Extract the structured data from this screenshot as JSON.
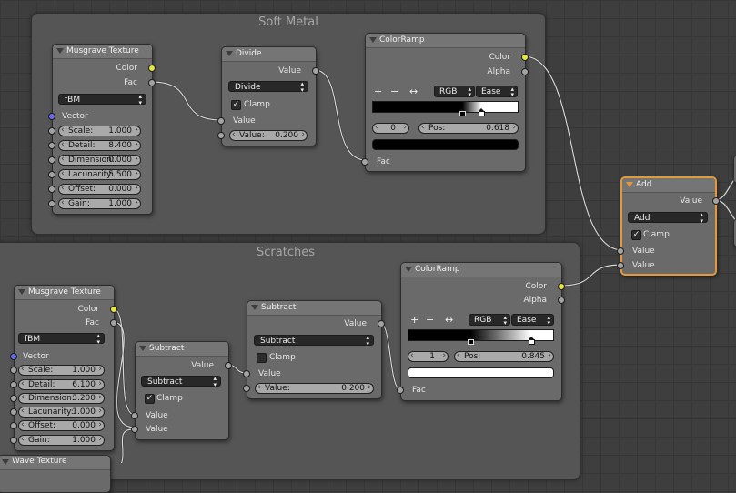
{
  "frames": [
    {
      "title": "Soft Metal"
    },
    {
      "title": "Scratches"
    }
  ],
  "nodes": {
    "musgrave1": {
      "title": "Musgrave Texture",
      "out_color": "Color",
      "out_fac": "Fac",
      "mode": "fBM",
      "vector": "Vector",
      "fields": [
        {
          "label": "Scale:",
          "value": "1.000"
        },
        {
          "label": "Detail:",
          "value": "8.400"
        },
        {
          "label": "Dimension:",
          "value": "0.000"
        },
        {
          "label": "Lacunarity:",
          "value": "5.500"
        },
        {
          "label": "Offset:",
          "value": "0.000"
        },
        {
          "label": "Gain:",
          "value": "1.000"
        }
      ]
    },
    "divide": {
      "title": "Divide",
      "out_value": "Value",
      "op": "Divide",
      "clamp": "Clamp",
      "clamp_checked": true,
      "in_value": "Value",
      "field_label": "Value:",
      "field_value": "0.200"
    },
    "ramp1": {
      "title": "ColorRamp",
      "out_color": "Color",
      "out_alpha": "Alpha",
      "plus": "+",
      "minus": "−",
      "flip": "↔",
      "color_mode": "RGB",
      "interp": "Ease",
      "index": "0",
      "pos_label": "Pos:",
      "pos_value": "0.618",
      "stops": [
        0.618,
        0.75
      ],
      "swatch_color": "#000000",
      "in_fac": "Fac"
    },
    "add": {
      "title": "Add",
      "out_value": "Value",
      "op": "Add",
      "clamp": "Clamp",
      "clamp_checked": true,
      "in_value1": "Value",
      "in_value2": "Value"
    },
    "musgrave2": {
      "title": "Musgrave Texture",
      "out_color": "Color",
      "out_fac": "Fac",
      "mode": "fBM",
      "vector": "Vector",
      "fields": [
        {
          "label": "Scale:",
          "value": "1.000"
        },
        {
          "label": "Detail:",
          "value": "6.100"
        },
        {
          "label": "Dimension:",
          "value": "3.200"
        },
        {
          "label": "Lacunarity:",
          "value": "1.000"
        },
        {
          "label": "Offset:",
          "value": "0.000"
        },
        {
          "label": "Gain:",
          "value": "1.000"
        }
      ]
    },
    "subtract1": {
      "title": "Subtract",
      "out_value": "Value",
      "op": "Subtract",
      "clamp": "Clamp",
      "clamp_checked": true,
      "in_value1": "Value",
      "in_value2": "Value"
    },
    "subtract2": {
      "title": "Subtract",
      "out_value": "Value",
      "op": "Subtract",
      "clamp": "Clamp",
      "clamp_checked": false,
      "in_value": "Value",
      "field_label": "Value:",
      "field_value": "0.200"
    },
    "ramp2": {
      "title": "ColorRamp",
      "out_color": "Color",
      "out_alpha": "Alpha",
      "plus": "+",
      "minus": "−",
      "flip": "↔",
      "color_mode": "RGB",
      "interp": "Ease",
      "index": "1",
      "pos_label": "Pos:",
      "pos_value": "0.845",
      "stops": [
        0.43,
        0.845
      ],
      "swatch_color": "#ffffff",
      "in_fac": "Fac"
    },
    "partial": {
      "title": "Wave Texture"
    }
  },
  "colors": {
    "socket_color": "#e6e645",
    "socket_value": "#a3a3a3",
    "socket_vector": "#6969e8",
    "active_outline": "#e49a3b"
  }
}
